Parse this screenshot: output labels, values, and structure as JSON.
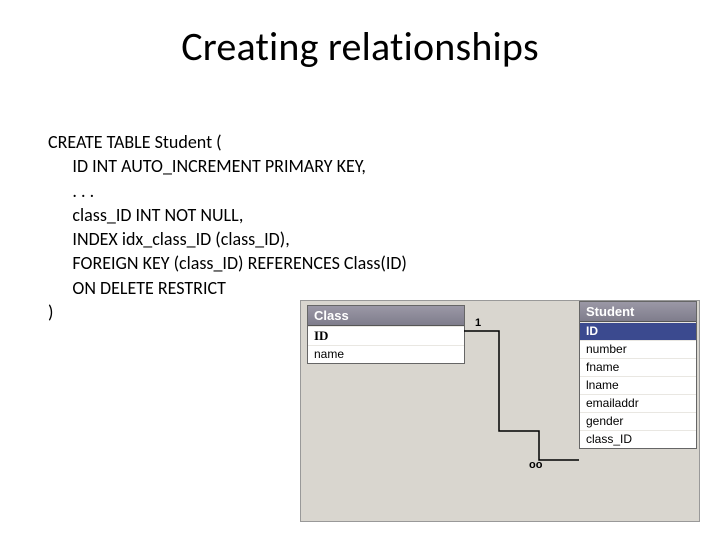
{
  "title": "Creating relationships",
  "code": "CREATE TABLE Student (\n      ID INT AUTO_INCREMENT PRIMARY KEY,\n      . . .\n      class_ID INT NOT NULL,\n      INDEX idx_class_ID (class_ID),\n      FOREIGN KEY (class_ID) REFERENCES Class(ID)\n      ON DELETE RESTRICT\n)",
  "er": {
    "class": {
      "name": "Class",
      "fields": [
        "ID",
        "name"
      ]
    },
    "student": {
      "name": "Student",
      "fields": [
        "ID",
        "number",
        "fname",
        "lname",
        "emailaddr",
        "gender",
        "class_ID"
      ]
    },
    "cardinality": {
      "left": "1",
      "right": "oo"
    }
  }
}
